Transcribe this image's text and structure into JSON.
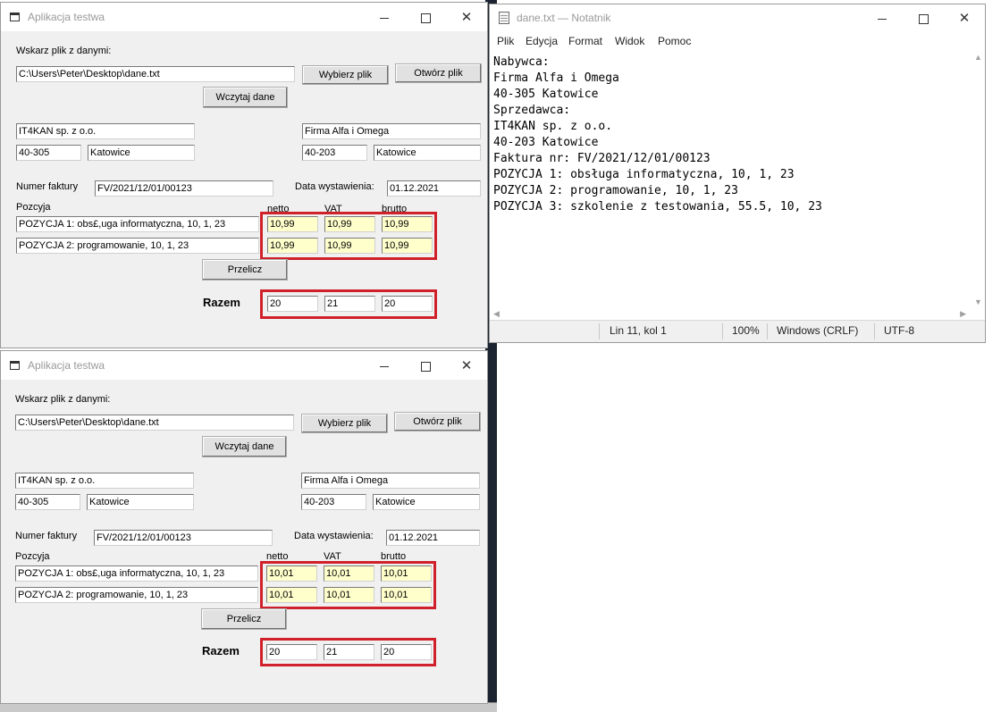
{
  "app": {
    "title": "Aplikacja testwa",
    "file_label": "Wskarz plik z danymi:",
    "file_path": "C:\\Users\\Peter\\Desktop\\dane.txt",
    "choose_file_btn": "Wybierz plik",
    "open_file_btn": "Otwórz plik",
    "load_btn": "Wczytaj dane",
    "seller_name": "IT4KAN sp. z o.o.",
    "seller_zip": "40-305",
    "seller_city": "Katowice",
    "buyer_name": "Firma Alfa i Omega",
    "buyer_zip": "40-203",
    "buyer_city": "Katowice",
    "invoice_label": "Numer faktury",
    "invoice_number": "FV/2021/12/01/00123",
    "date_label": "Data wystawienia:",
    "date_value": "01.12.2021",
    "pos_label": "Pozcyja",
    "netto_label": "netto",
    "vat_label": "VAT",
    "brutto_label": "brutto",
    "pos1": "POZYCJA 1: obs£,uga informatyczna, 10, 1, 23",
    "pos2": "POZYCJA 2: programowanie, 10, 1, 23",
    "recalc_btn": "Przelicz",
    "total_label": "Razem",
    "total_netto": "20",
    "total_vat": "21",
    "total_brutto": "20"
  },
  "window1": {
    "values": {
      "netto": "10,99",
      "vat": "10,99",
      "brutto": "10,99"
    }
  },
  "window2": {
    "values": {
      "netto": "10,01",
      "vat": "10,01",
      "brutto": "10,01"
    }
  },
  "notepad": {
    "title": "dane.txt — Notatnik",
    "menu": [
      "Plik",
      "Edycja",
      "Format",
      "Widok",
      "Pomoc"
    ],
    "lines": [
      "Nabywca:",
      "Firma Alfa i Omega",
      "40-305 Katowice",
      "Sprzedawca:",
      "IT4KAN sp. z o.o.",
      "40-203 Katowice",
      "Faktura nr: FV/2021/12/01/00123",
      "POZYCJA 1: obsługa informatyczna, 10, 1, 23",
      "POZYCJA 2: programowanie, 10, 1, 23",
      "POZYCJA 3: szkolenie z testowania, 55.5, 10, 23"
    ],
    "status": {
      "position": "Lin 11, kol 1",
      "zoom": "100%",
      "line_ending": "Windows (CRLF)",
      "encoding": "UTF-8"
    }
  }
}
